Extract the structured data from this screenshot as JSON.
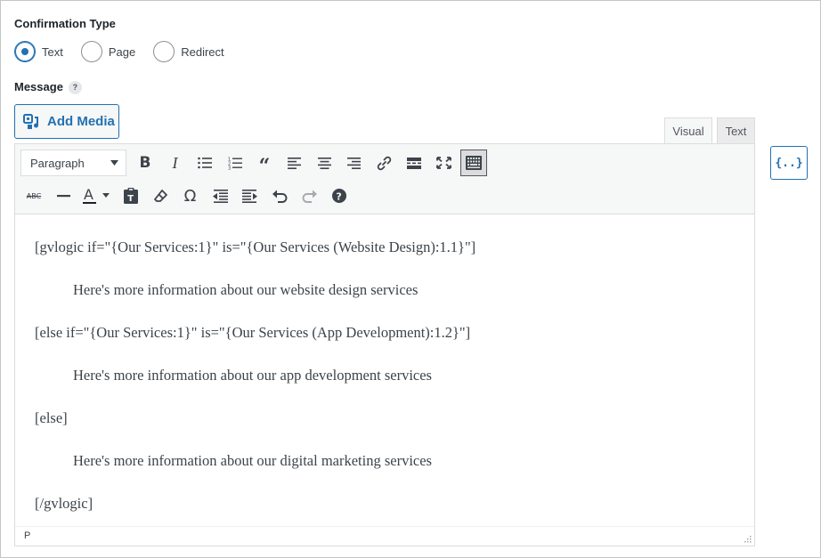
{
  "confirmation": {
    "label": "Confirmation Type",
    "options": [
      {
        "label": "Text",
        "checked": true
      },
      {
        "label": "Page",
        "checked": false
      },
      {
        "label": "Redirect",
        "checked": false
      }
    ]
  },
  "message": {
    "label": "Message",
    "help": "?"
  },
  "editor": {
    "add_media_label": "Add Media",
    "tabs": {
      "visual": "Visual",
      "text": "Text"
    },
    "format_select": "Paragraph",
    "merge_tags_label": "{..}",
    "toolbar_row1_icons": [
      "bold-icon",
      "italic-icon",
      "bulleted-list-icon",
      "numbered-list-icon",
      "blockquote-icon",
      "align-left-icon",
      "align-center-icon",
      "align-right-icon",
      "link-icon",
      "read-more-icon",
      "fullscreen-icon",
      "toolbar-toggle-icon"
    ],
    "toolbar_row2_icons": [
      "strikethrough-icon",
      "horizontal-line-icon",
      "text-color-icon",
      "paste-text-icon",
      "clear-formatting-icon",
      "special-character-icon",
      "outdent-icon",
      "indent-icon",
      "undo-icon",
      "redo-icon",
      "keyboard-help-icon"
    ],
    "content": [
      {
        "text": "[gvlogic if=\"{Our Services:1}\" is=\"{Our Services (Website Design):1.1}\"]",
        "indent": false
      },
      {
        "text": "Here's more information about our website design services",
        "indent": true
      },
      {
        "text": "[else if=\"{Our Services:1}\" is=\"{Our Services (App Development):1.2}\"]",
        "indent": false
      },
      {
        "text": "Here's more information about our app development services",
        "indent": true
      },
      {
        "text": "[else]",
        "indent": false
      },
      {
        "text": "Here's more information about our digital marketing services",
        "indent": true
      },
      {
        "text": "[/gvlogic]",
        "indent": false
      }
    ],
    "status_path": "P"
  },
  "colors": {
    "accent": "#2271b1",
    "border": "#dcdcde",
    "toolbar_bg": "#f6f7f7"
  }
}
